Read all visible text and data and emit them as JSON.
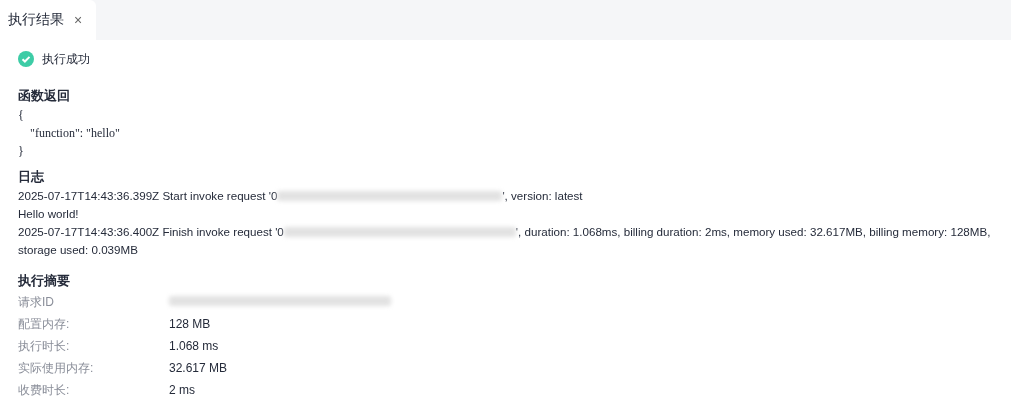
{
  "tabs": [
    {
      "label": "执行结果",
      "selected": true,
      "close": "×"
    }
  ],
  "status": {
    "text": "执行成功",
    "kind": "success"
  },
  "return_section": {
    "title": "函数返回",
    "lines": [
      "{",
      "    \"function\": \"hello\"",
      "}"
    ]
  },
  "log_section": {
    "title": "日志",
    "lines": [
      {
        "before": "2025-07-17T14:43:36.399Z Start invoke request '0",
        "redacted": true,
        "after": "', version: latest"
      },
      {
        "before": "Hello world!"
      },
      {
        "before": "2025-07-17T14:43:36.400Z Finish invoke request '0",
        "redacted": true,
        "after": "', duration: 1.068ms, billing duration: 2ms, memory used: 32.617MB, billing memory: 128MB,",
        "continuation": "storage used: 0.039MB"
      }
    ]
  },
  "summary_section": {
    "title": "执行摘要",
    "rows": [
      {
        "label": "请求ID",
        "redacted": true
      },
      {
        "label": "配置内存:",
        "value": "128 MB"
      },
      {
        "label": "执行时长:",
        "value": "1.068 ms"
      },
      {
        "label": "实际使用内存:",
        "value": "32.617 MB"
      },
      {
        "label": "收费时长:",
        "value": "2 ms"
      }
    ]
  }
}
